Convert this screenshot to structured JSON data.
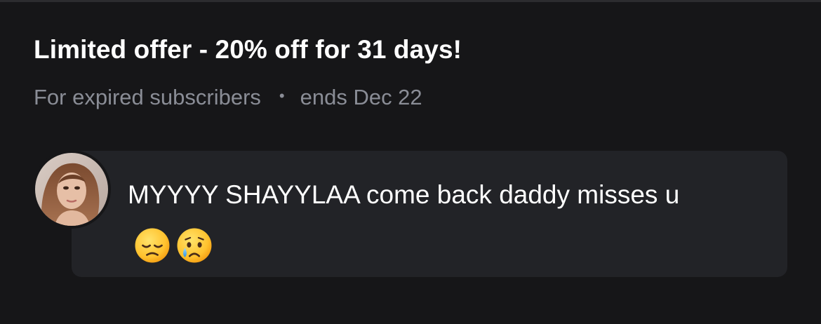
{
  "offer": {
    "title": "Limited offer - 20% off for 31 days!",
    "audience": "For expired subscribers",
    "separator": "•",
    "ends": "ends Dec 22"
  },
  "message": {
    "text": "MYYYY SHAYYLAA come back daddy misses u",
    "emojis": [
      "disappointed-face-emoji",
      "crying-face-emoji"
    ]
  },
  "colors": {
    "background": "#161618",
    "card": "#222327",
    "title": "#ffffff",
    "meta": "#8a8d96"
  }
}
